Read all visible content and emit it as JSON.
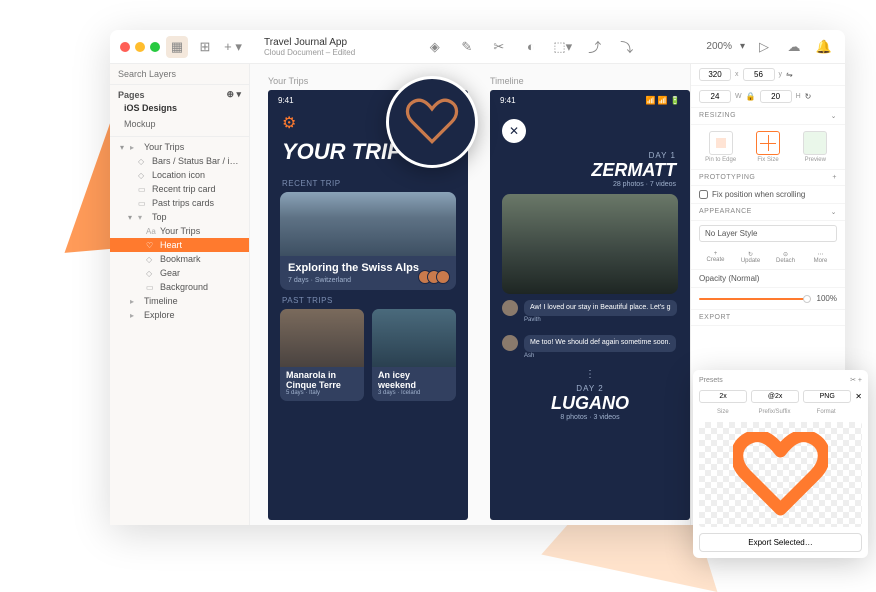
{
  "document": {
    "title": "Travel Journal App",
    "subtitle": "Cloud Document – Edited"
  },
  "toolbar": {
    "zoom": "200%"
  },
  "sidebar": {
    "search_placeholder": "Search Layers",
    "pages_label": "Pages",
    "pages": [
      "iOS Designs",
      "Mockup"
    ],
    "layers": [
      {
        "d": 0,
        "ico": "▸",
        "label": "Your Trips",
        "sel": false,
        "open": true
      },
      {
        "d": 1,
        "ico": "◇",
        "label": "Bars / Status Bar / iPhone…",
        "sel": false
      },
      {
        "d": 1,
        "ico": "◇",
        "label": "Location icon",
        "sel": false
      },
      {
        "d": 1,
        "ico": "▭",
        "label": "Recent trip card",
        "sel": false
      },
      {
        "d": 1,
        "ico": "▭",
        "label": "Past trips cards",
        "sel": false
      },
      {
        "d": 1,
        "ico": "▾",
        "label": "Top",
        "sel": false,
        "open": true
      },
      {
        "d": 2,
        "ico": "Aa",
        "label": "Your Trips",
        "sel": false
      },
      {
        "d": 2,
        "ico": "♡",
        "label": "Heart",
        "sel": true
      },
      {
        "d": 2,
        "ico": "◇",
        "label": "Bookmark",
        "sel": false
      },
      {
        "d": 2,
        "ico": "◇",
        "label": "Gear",
        "sel": false
      },
      {
        "d": 2,
        "ico": "▭",
        "label": "Background",
        "sel": false
      },
      {
        "d": 0,
        "ico": "▸",
        "label": "Timeline",
        "sel": false
      },
      {
        "d": 0,
        "ico": "▸",
        "label": "Explore",
        "sel": false
      }
    ]
  },
  "artboards": {
    "a": "Your Trips",
    "b": "Timeline"
  },
  "artboard1": {
    "time": "9:41",
    "title": "YOUR TRIPS",
    "recent_label": "RECENT TRIP",
    "recent": {
      "title": "Exploring the Swiss Alps",
      "meta": "7 days · Switzerland"
    },
    "past_label": "PAST TRIPS",
    "past": [
      {
        "title": "Manarola in Cinque Terre",
        "meta": "5 days · Italy"
      },
      {
        "title": "An icey weekend",
        "meta": "3 days · Iceland"
      }
    ]
  },
  "artboard2": {
    "time": "9:41",
    "day1": {
      "label": "DAY 1",
      "title": "ZERMATT",
      "meta": "28 photos · 7 videos"
    },
    "chats": [
      {
        "name": "Pavith",
        "text": "Aw! I loved our stay in Beautiful place. Let's g"
      },
      {
        "name": "Ash",
        "text": "Me too! We should def again sometime soon."
      }
    ],
    "day2": {
      "label": "DAY 2",
      "title": "LUGANO",
      "meta": "8 photos · 3 videos"
    }
  },
  "inspector": {
    "x": "320",
    "y": "56",
    "w": "24",
    "h": "20",
    "resizing_label": "RESIZING",
    "resize_modes": [
      "Pin to Edge",
      "Fix Size",
      "Preview"
    ],
    "proto_label": "PROTOTYPING",
    "fix_scroll": "Fix position when scrolling",
    "appearance_label": "APPEARANCE",
    "layer_style": "No Layer Style",
    "style_btns": [
      "Create",
      "Update",
      "Detach",
      "More"
    ],
    "opacity_label": "Opacity (Normal)",
    "opacity_val": "100%",
    "export_label": "EXPORT"
  },
  "export": {
    "presets": "Presets",
    "size": "2x",
    "prefix": "@2x",
    "format": "PNG",
    "labels": [
      "Size",
      "Prefix/Suffix",
      "Format"
    ],
    "button": "Export Selected…"
  }
}
